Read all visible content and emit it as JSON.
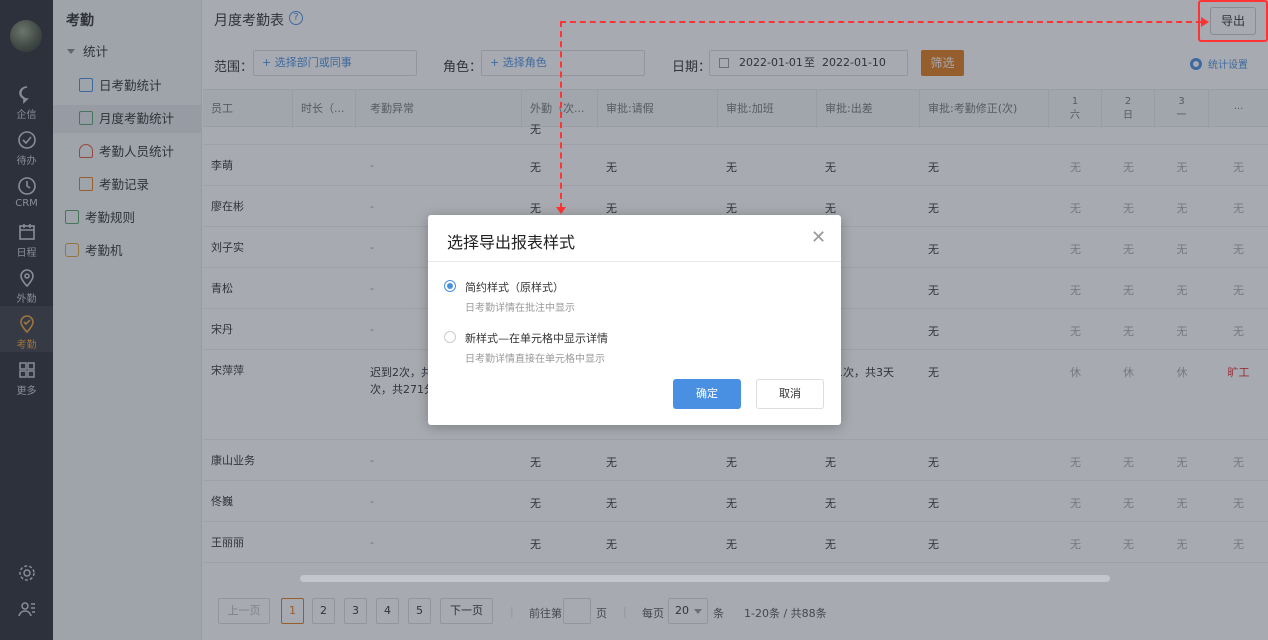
{
  "rail": {
    "items": [
      {
        "label": "企信",
        "icon": "chat-icon"
      },
      {
        "label": "待办",
        "icon": "check-circle-icon"
      },
      {
        "label": "CRM",
        "icon": "clock-icon"
      },
      {
        "label": "日程",
        "icon": "calendar-icon"
      },
      {
        "label": "外勤",
        "icon": "location-icon"
      },
      {
        "label": "考勤",
        "icon": "attendance-icon"
      },
      {
        "label": "更多",
        "icon": "grid-icon"
      }
    ],
    "active": "考勤"
  },
  "submenu": {
    "title": "考勤",
    "group": "统计",
    "items": [
      {
        "label": "日考勤统计"
      },
      {
        "label": "月度考勤统计"
      },
      {
        "label": "考勤人员统计"
      },
      {
        "label": "考勤记录"
      },
      {
        "label": "考勤规则"
      },
      {
        "label": "考勤机"
      }
    ]
  },
  "header": {
    "title": "月度考勤表",
    "help": "?",
    "export_label": "导出"
  },
  "filters": {
    "scope_label": "范围：",
    "scope_placeholder": "+ 选择部门或同事",
    "role_label": "角色：",
    "role_placeholder": "+ 选择角色",
    "date_label": "日期：",
    "date_from": "2022-01-01",
    "date_to_sep": "至",
    "date_to": "2022-01-10",
    "filter_button": "筛选",
    "stat_settings": "统计设置"
  },
  "table": {
    "headers": [
      "员工",
      "时长（...",
      "考勤异常",
      "外勤（次...",
      "审批:请假",
      "审批:加班",
      "审批:出差",
      "审批:考勤修正(次)"
    ],
    "day_headers": [
      {
        "num": "1",
        "week": "六"
      },
      {
        "num": "2",
        "week": "日"
      },
      {
        "num": "3",
        "week": "一"
      }
    ],
    "more": "...",
    "partial_top": "无",
    "rows": [
      {
        "name": "李萌",
        "abnormal": "-",
        "outwork": "无",
        "leave": "无",
        "overtime": "无",
        "trip": "无",
        "fix": "无",
        "d1": "无",
        "d2": "无",
        "d3": "无",
        "d4": "无"
      },
      {
        "name": "廖在彬",
        "abnormal": "-",
        "outwork": "无",
        "leave": "无",
        "overtime": "无",
        "trip": "无",
        "fix": "无",
        "d1": "无",
        "d2": "无",
        "d3": "无",
        "d4": "无"
      },
      {
        "name": "刘子实",
        "abnormal": "-",
        "outwork": "",
        "leave": "",
        "overtime": "",
        "trip": "",
        "fix": "无",
        "d1": "无",
        "d2": "无",
        "d3": "无",
        "d4": "无"
      },
      {
        "name": "青松",
        "abnormal": "-",
        "outwork": "",
        "leave": "",
        "overtime": "",
        "trip": "",
        "fix": "无",
        "d1": "无",
        "d2": "无",
        "d3": "无",
        "d4": "无"
      },
      {
        "name": "宋丹",
        "abnormal": "-",
        "outwork": "",
        "leave": "",
        "overtime": "",
        "trip": "",
        "fix": "无",
        "d1": "无",
        "d2": "无",
        "d3": "无",
        "d4": "无"
      },
      {
        "name": "宋萍萍",
        "abnormal": "迟到2次，共4",
        "abnormal2": "次，共271分钟",
        "outwork": "",
        "leave": "",
        "overtime": "",
        "trip": "差1次，共3天",
        "fix": "无",
        "d1": "休",
        "d2": "休",
        "d3": "休",
        "d4": "旷工"
      },
      {
        "name": "康山业务",
        "abnormal": "-",
        "outwork": "无",
        "leave": "无",
        "overtime": "无",
        "trip": "无",
        "fix": "无",
        "d1": "无",
        "d2": "无",
        "d3": "无",
        "d4": "无"
      },
      {
        "name": "佟巍",
        "abnormal": "-",
        "outwork": "无",
        "leave": "无",
        "overtime": "无",
        "trip": "无",
        "fix": "无",
        "d1": "无",
        "d2": "无",
        "d3": "无",
        "d4": "无"
      },
      {
        "name": "王丽丽",
        "abnormal": "-",
        "outwork": "无",
        "leave": "无",
        "overtime": "无",
        "trip": "无",
        "fix": "无",
        "d1": "无",
        "d2": "无",
        "d3": "无",
        "d4": "无"
      }
    ]
  },
  "pager": {
    "prev": "上一页",
    "pages": [
      "1",
      "2",
      "3",
      "4",
      "5"
    ],
    "next": "下一页",
    "goto_label": "前往第",
    "goto_unit": "页",
    "per_page_label": "每页",
    "per_page": "20",
    "per_page_unit": "条",
    "summary": "1-20条 / 共88条"
  },
  "modal": {
    "title": "选择导出报表样式",
    "close": "✕",
    "options": [
      {
        "label": "简约样式（原样式）",
        "sub": "日考勤详情在批注中显示",
        "selected": true
      },
      {
        "label": "新样式—在单元格中显示详情",
        "sub": "日考勤详情直接在单元格中显示",
        "selected": false
      }
    ],
    "ok": "确定",
    "cancel": "取消"
  },
  "colors": {
    "accent": "#4a90e2",
    "filter_button": "#e27d1e",
    "rail": "#2d3037",
    "rail_active": "#f0a33a",
    "annotation": "#ff3333"
  }
}
